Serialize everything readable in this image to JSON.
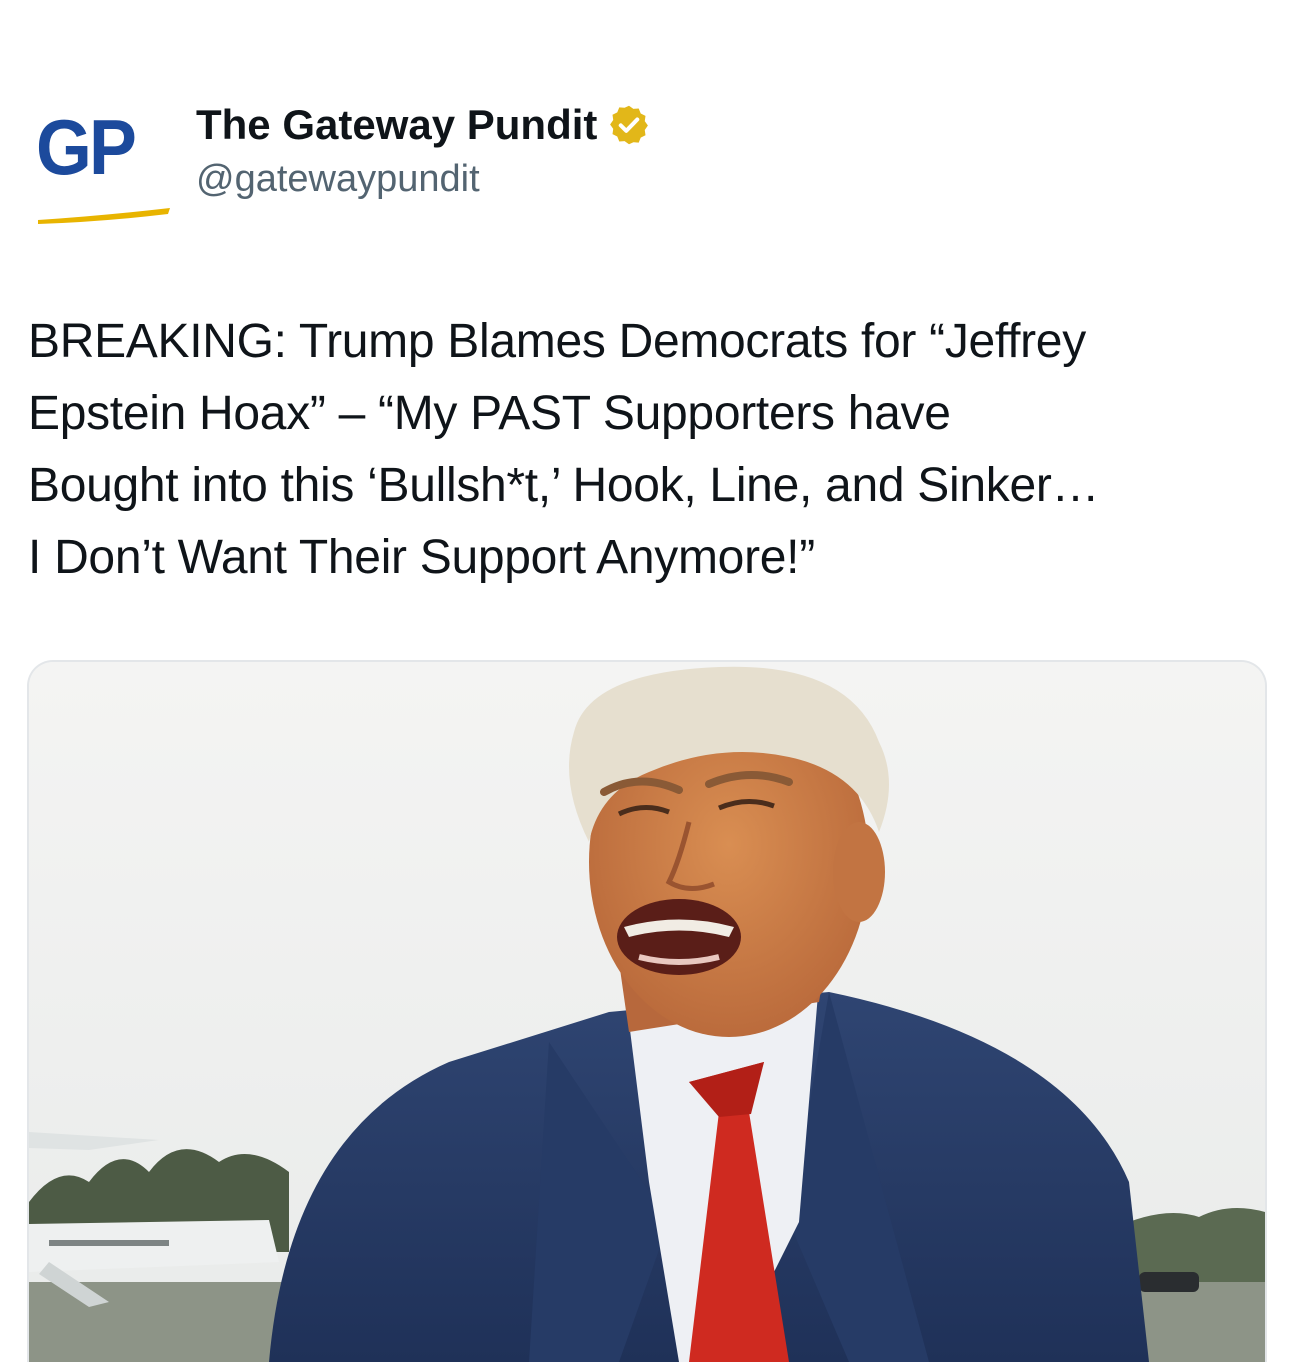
{
  "author": {
    "avatar_text": "GP",
    "display_name": "The Gateway Pundit",
    "handle": "@gatewaypundit",
    "verified_badge": "gold-verified-icon"
  },
  "tweet": {
    "text": "BREAKING: Trump Blames Democrats for “Jeffrey\nEpstein Hoax”  – “My PAST Supporters have\nBought into this ‘Bullsh*t,’ Hook, Line, and Sinker…\nI Don’t Want Their Support Anymore!”"
  },
  "media": {
    "kind": "photo"
  },
  "colors": {
    "brand_blue": "#1c4a9c",
    "brand_gold": "#e8b400",
    "verified_gold": "#e2b719",
    "handle_gray": "#536471"
  }
}
